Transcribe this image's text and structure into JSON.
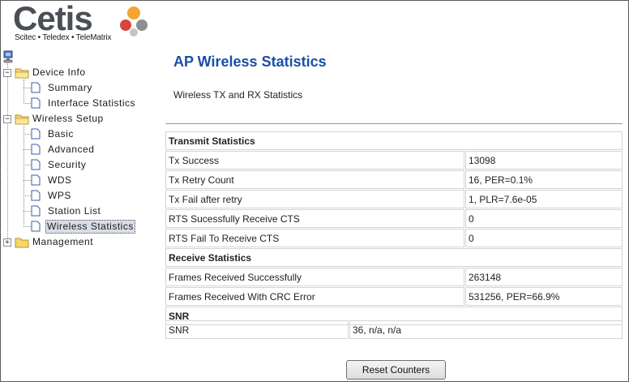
{
  "logo": {
    "brand": "Cetis",
    "tagline": "Scitec • Teledex • TeleMatrix"
  },
  "tree": {
    "device_info": {
      "label": "Device Info",
      "expander": "−",
      "children": [
        "Summary",
        "Interface Statistics"
      ]
    },
    "wireless_setup": {
      "label": "Wireless Setup",
      "expander": "−",
      "children": [
        "Basic",
        "Advanced",
        "Security",
        "WDS",
        "WPS",
        "Station List",
        "Wireless Statistics"
      ],
      "selected": "Wireless Statistics"
    },
    "management": {
      "label": "Management",
      "expander": "+"
    }
  },
  "main": {
    "title": "AP Wireless Statistics",
    "subtitle": "Wireless TX and RX Statistics",
    "transmit": {
      "heading": "Transmit Statistics",
      "rows": [
        {
          "label": "Tx Success",
          "value": "13098"
        },
        {
          "label": "Tx Retry Count",
          "value": "16, PER=0.1%"
        },
        {
          "label": "Tx Fail after retry",
          "value": "1, PLR=7.6e-05"
        },
        {
          "label": "RTS Sucessfully Receive CTS",
          "value": "0"
        },
        {
          "label": "RTS Fail To Receive CTS",
          "value": "0"
        }
      ]
    },
    "receive": {
      "heading": "Receive Statistics",
      "rows": [
        {
          "label": "Frames Received Successfully",
          "value": "263148"
        },
        {
          "label": "Frames Received With CRC Error",
          "value": "531256, PER=66.9%"
        }
      ]
    },
    "snr": {
      "heading": "SNR",
      "label": "SNR",
      "value": "36, n/a, n/a"
    },
    "reset_button": "Reset Counters"
  },
  "colors": {
    "title": "#1a4ea8",
    "border": "#d4d4d4"
  }
}
